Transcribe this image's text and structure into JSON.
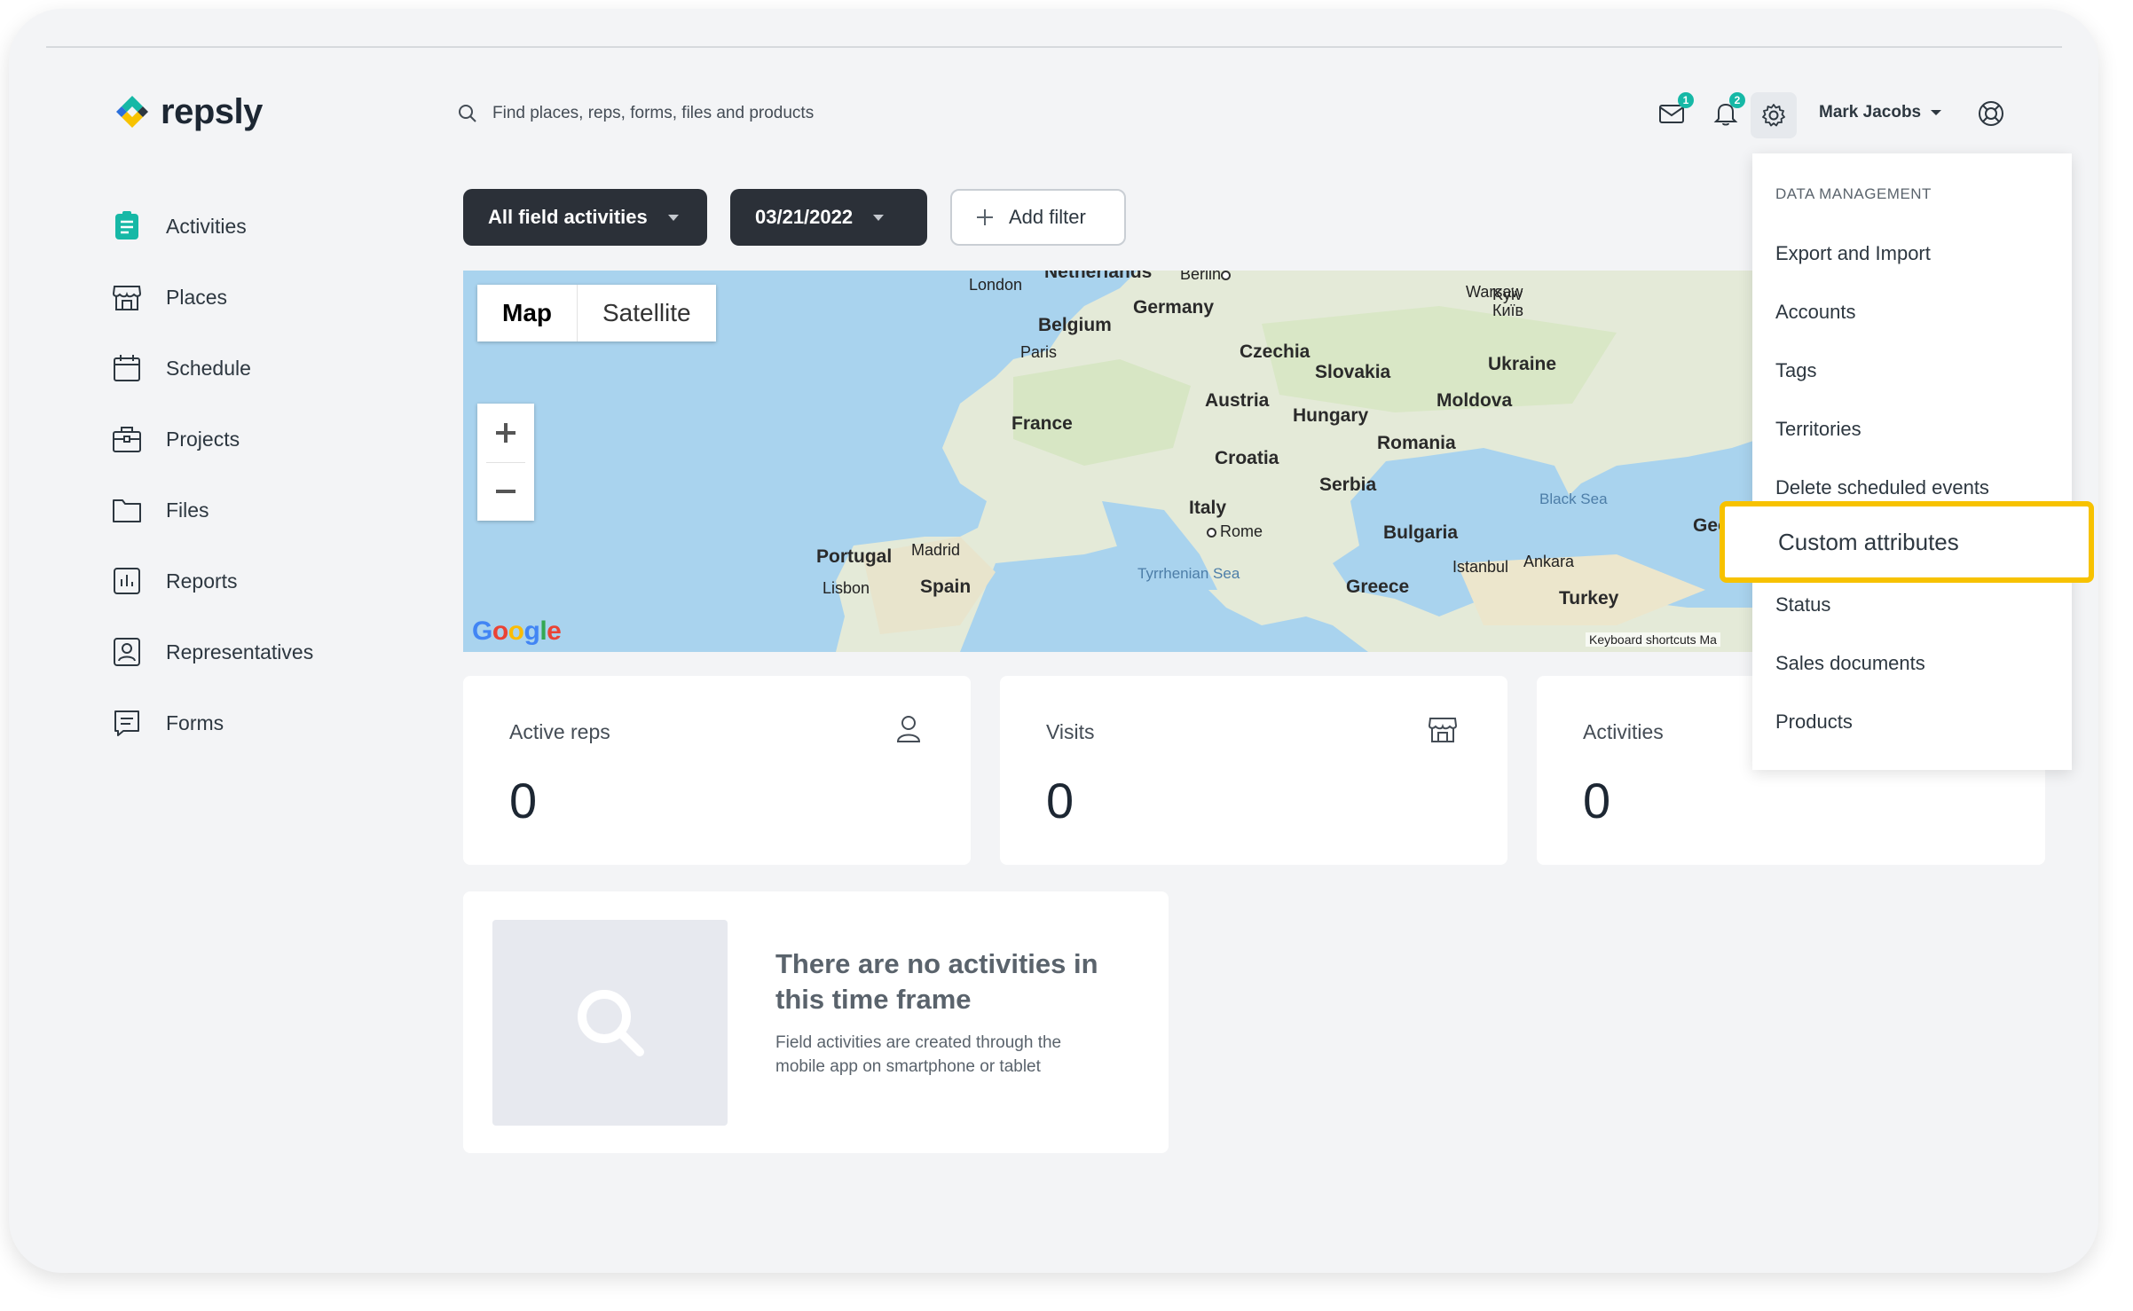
{
  "brand": {
    "name": "repsly"
  },
  "search": {
    "placeholder": "Find places, reps, forms, files and products"
  },
  "header": {
    "messages_badge": "1",
    "notifications_badge": "2",
    "user_name": "Mark Jacobs"
  },
  "sidebar": {
    "items": [
      {
        "label": "Activities",
        "icon": "activities-icon",
        "active": true
      },
      {
        "label": "Places",
        "icon": "store-icon"
      },
      {
        "label": "Schedule",
        "icon": "calendar-icon"
      },
      {
        "label": "Projects",
        "icon": "briefcase-icon"
      },
      {
        "label": "Files",
        "icon": "folder-icon"
      },
      {
        "label": "Reports",
        "icon": "chart-icon"
      },
      {
        "label": "Representatives",
        "icon": "person-badge-icon"
      },
      {
        "label": "Forms",
        "icon": "form-icon"
      }
    ]
  },
  "filters": {
    "activity_type": "All field activities",
    "date": "03/21/2022",
    "add_filter": "Add filter"
  },
  "map": {
    "toggle_map": "Map",
    "toggle_satellite": "Satellite",
    "zoom_in": "+",
    "zoom_out": "−",
    "google": "Google",
    "keyboard_shortcuts": "Keyboard shortcuts",
    "trailing": "Ma",
    "countries": [
      "Netherlands",
      "Belgium",
      "Germany",
      "France",
      "Czechia",
      "Slovakia",
      "Austria",
      "Hungary",
      "Ukraine",
      "Moldova",
      "Romania",
      "Croatia",
      "Serbia",
      "Italy",
      "Bulgaria",
      "Portugal",
      "Spain",
      "Greece",
      "Turkey",
      "Georgia"
    ],
    "cities": [
      "London",
      "Berlin",
      "Warsaw",
      "Kyiv Київ",
      "Paris",
      "Rome",
      "Madrid",
      "Lisbon",
      "Istanbul",
      "Ankara"
    ],
    "seas": [
      "Black Sea",
      "Tyrrhenian Sea"
    ]
  },
  "stats": [
    {
      "title": "Active reps",
      "value": "0",
      "icon": "person-icon"
    },
    {
      "title": "Visits",
      "value": "0",
      "icon": "store-icon"
    },
    {
      "title": "Activities",
      "value": "0"
    }
  ],
  "empty_state": {
    "title": "There are no activities in this time frame",
    "description": "Field activities are created through the mobile app on smartphone or tablet"
  },
  "dropdown": {
    "header": "DATA MANAGEMENT",
    "items": [
      "Export and Import",
      "Accounts",
      "Tags",
      "Territories",
      "Delete scheduled events",
      "Custom attributes",
      "Status",
      "Sales documents",
      "Products"
    ]
  },
  "colors": {
    "accent": "#16b8a6",
    "highlight": "#f7c200",
    "dark_button": "#2b3038"
  }
}
